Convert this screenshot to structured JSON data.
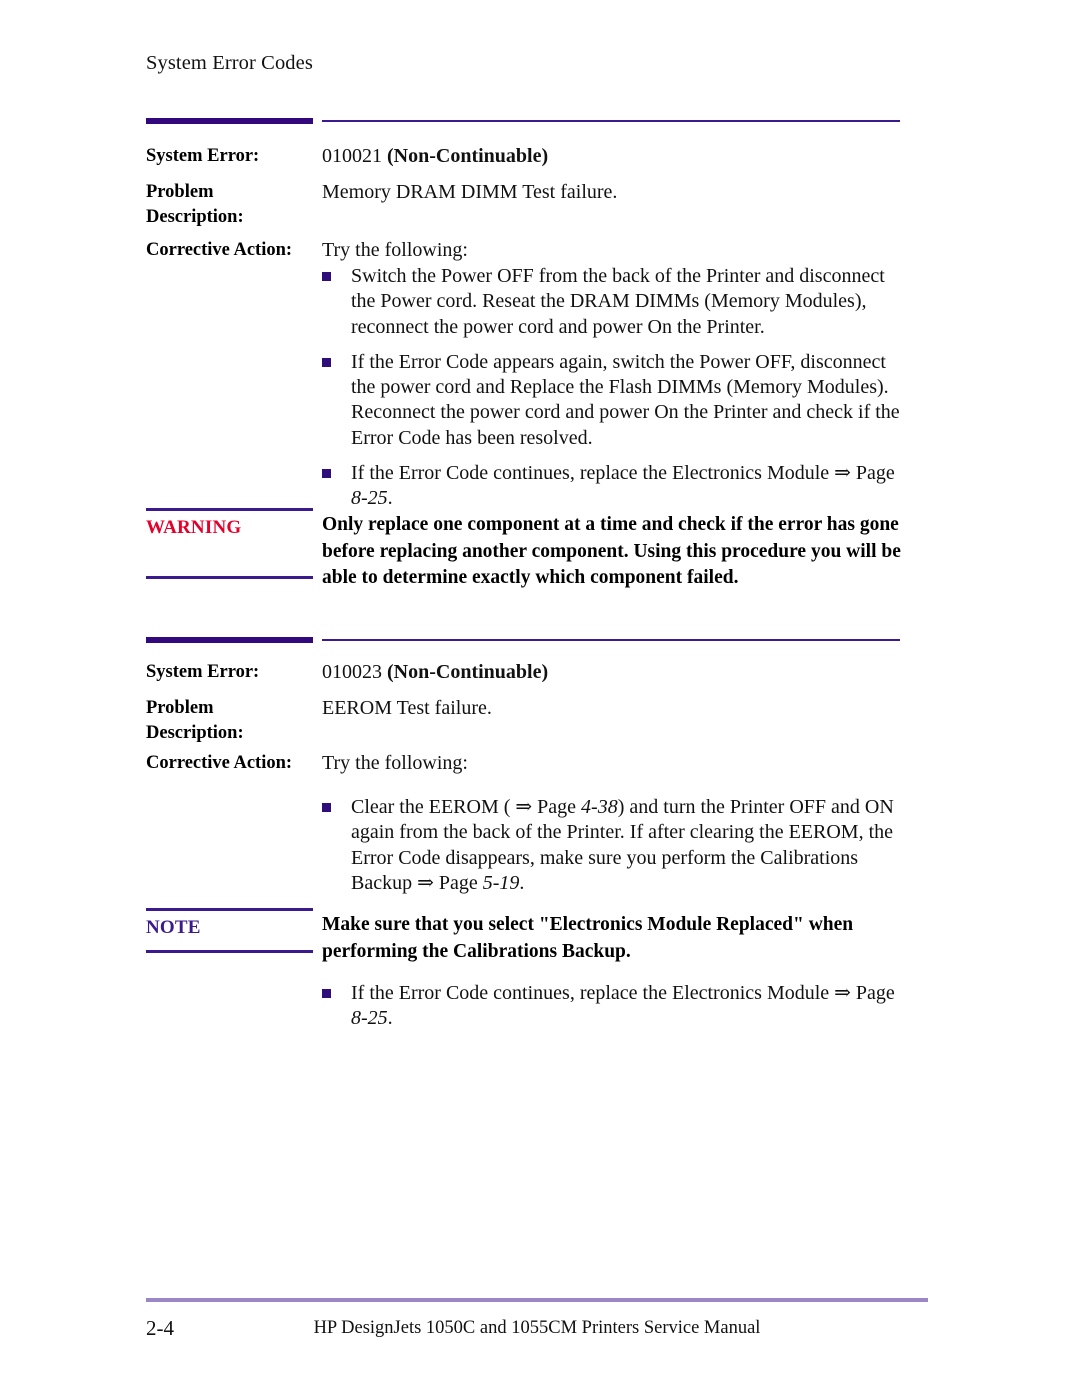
{
  "document": {
    "running_header": "System Error Codes",
    "footer": {
      "page_number": "2-4",
      "manual_title": "HP DesignJets 1050C and 1055CM Printers Service Manual"
    }
  },
  "labels": {
    "system_error": "System Error:",
    "problem": "Problem",
    "description": "Description:",
    "corrective_action": "Corrective Action:"
  },
  "entries": [
    {
      "code": "010021 ",
      "code_kind": "(Non-Continuable)",
      "problem_description": "Memory DRAM DIMM Test failure.",
      "corrective_intro": "Try the following:",
      "bullets": [
        "Switch the Power OFF from the back of the Printer and disconnect the Power cord. Reseat the DRAM DIMMs (Memory Modules), reconnect the power cord and power On the Printer.",
        "If the Error Code appears again, switch the Power OFF, disconnect the power cord and Replace the Flash DIMMs (Memory Modules). Reconnect the power cord and power On the Printer and check if the Error Code has been resolved.",
        "If the Error Code continues, replace the Electronics Module ⇒ Page 8-25."
      ]
    },
    {
      "code": "010023 ",
      "code_kind": "(Non-Continuable)",
      "problem_description": "EEROM Test failure.",
      "corrective_intro": "Try the following:",
      "bullets": [
        "Clear the EEROM ( ⇒ Page 4-38) and turn the Printer OFF and ON again from the back of the Printer. If after clearing the EEROM, the Error Code disappears, make sure you perform the Calibrations Backup ⇒ Page 5-19.",
        "If the Error Code continues, replace the Electronics Module ⇒ Page 8-25."
      ]
    }
  ],
  "admonitions": {
    "warning": {
      "tag": "WARNING",
      "text": "Only replace one component at a time and check if the error has gone before replacing another component. Using this procedure you will be able to determine exactly which component failed.",
      "color": "#e4002b"
    },
    "note": {
      "tag": "NOTE",
      "text": "Make sure that you select \"Electronics Module Replaced\" when performing the Calibrations Backup.",
      "color": "#3a1a8c"
    }
  },
  "colors": {
    "rule_dark": "#33087c",
    "rule_thin": "#3a1a8c",
    "bullet_marker": "#2f0d7a",
    "footer_rule": "#9b86c6"
  }
}
